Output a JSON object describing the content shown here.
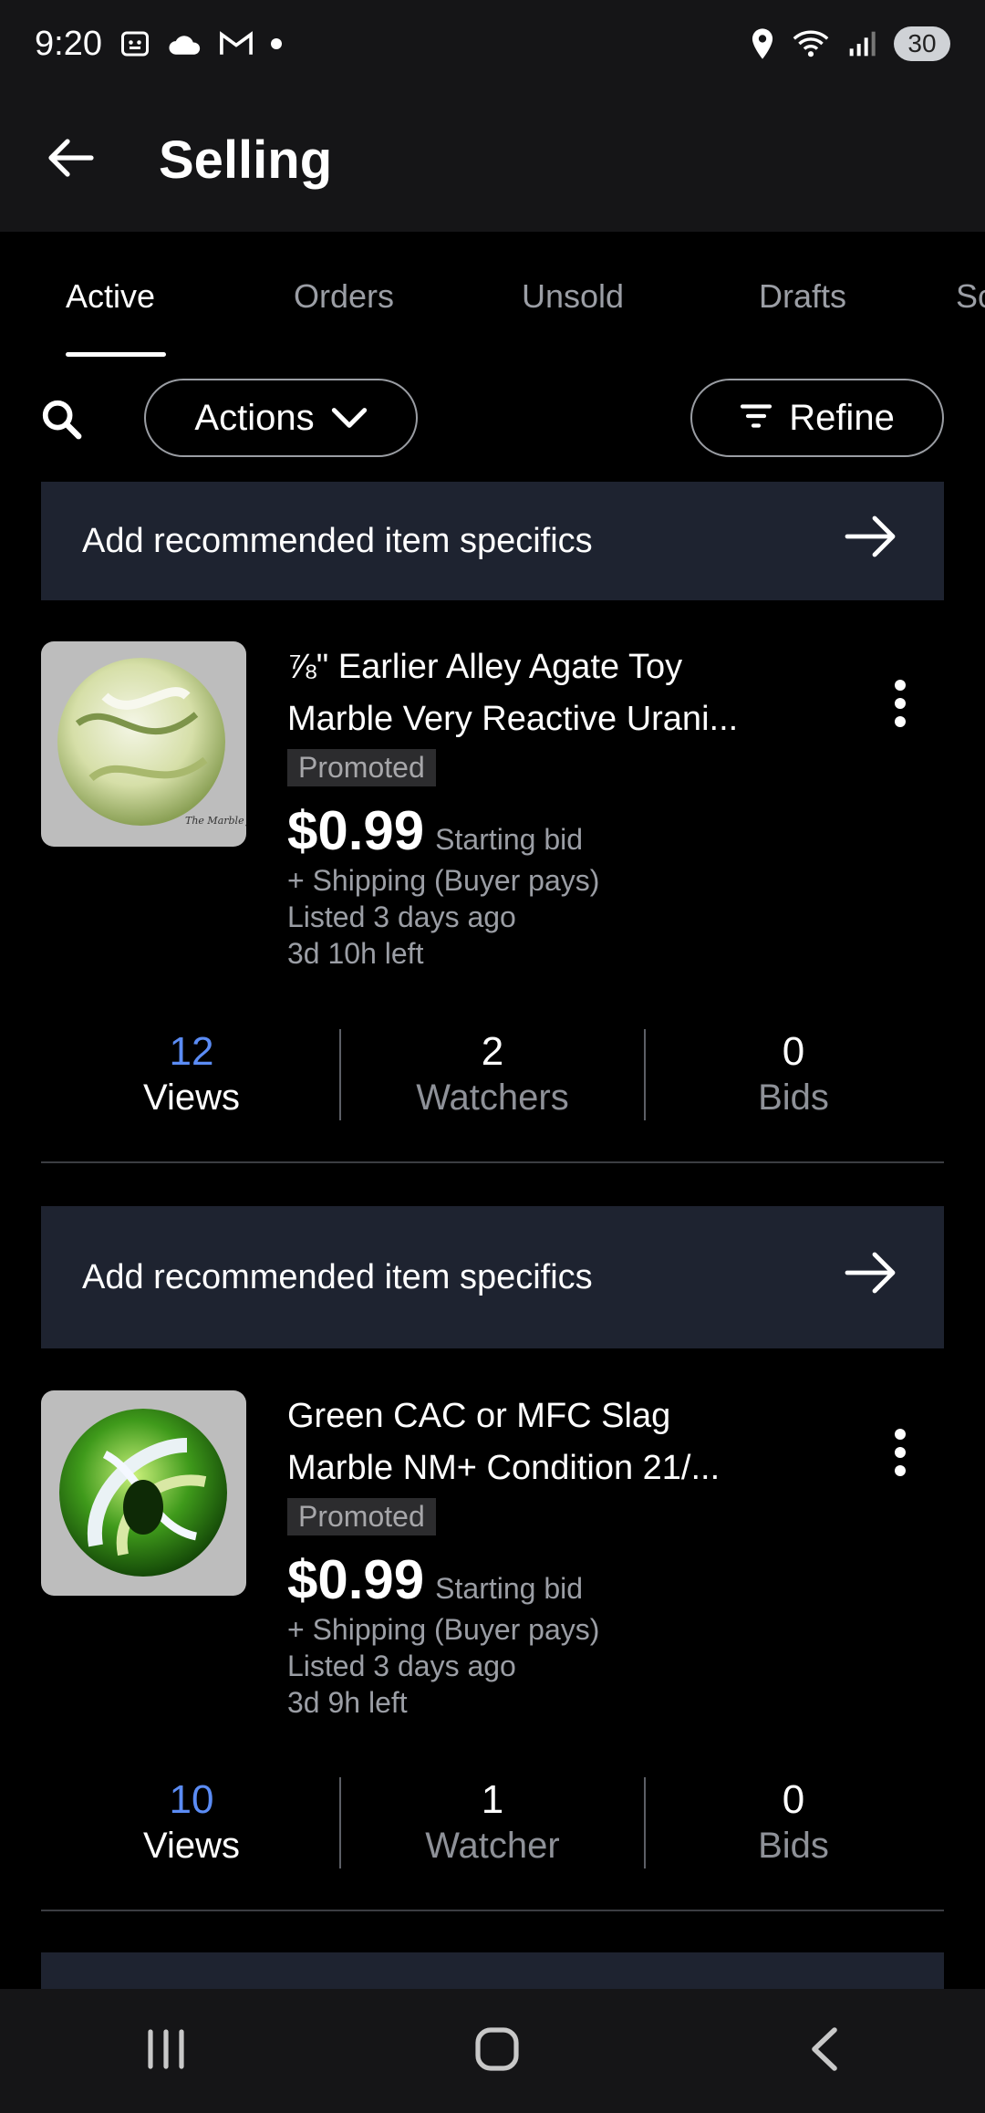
{
  "status_bar": {
    "time": "9:20",
    "battery": "30",
    "left_icons": [
      "screenshot-icon",
      "cloud-icon",
      "gmail-icon",
      "dot-icon"
    ],
    "right_icons": [
      "location-icon",
      "wifi-icon",
      "signal-icon"
    ]
  },
  "app_bar": {
    "title": "Selling"
  },
  "tabs": [
    {
      "label": "Active",
      "active": true
    },
    {
      "label": "Orders",
      "active": false
    },
    {
      "label": "Unsold",
      "active": false
    },
    {
      "label": "Drafts",
      "active": false
    },
    {
      "label": "Sc",
      "active": false
    }
  ],
  "toolbar": {
    "actions_label": "Actions",
    "refine_label": "Refine"
  },
  "banner_text": "Add recommended item specifics",
  "listings": [
    {
      "title_line1": "⅞\" Earlier Alley Agate Toy",
      "title_line2": "Marble Very Reactive Urani...",
      "badge": "Promoted",
      "price": "$0.99",
      "bid_type": "Starting bid",
      "shipping": "+ Shipping (Buyer pays)",
      "listed": "Listed 3 days ago",
      "time_left": "3d 10h left",
      "thumb_caption": "The Marble Junkie",
      "stats": {
        "views": "12",
        "views_label": "Views",
        "watchers": "2",
        "watchers_label": "Watchers",
        "bids": "0",
        "bids_label": "Bids"
      }
    },
    {
      "title_line1": "Green CAC or MFC Slag",
      "title_line2": "Marble NM+  Condition 21/...",
      "badge": "Promoted",
      "price": "$0.99",
      "bid_type": "Starting bid",
      "shipping": "+ Shipping (Buyer pays)",
      "listed": "Listed 3 days ago",
      "time_left": "3d 9h left",
      "stats": {
        "views": "10",
        "views_label": "Views",
        "watchers": "1",
        "watchers_label": "Watcher",
        "bids": "0",
        "bids_label": "Bids"
      }
    }
  ],
  "colors": {
    "accent_blue": "#5b8cf5",
    "banner_bg": "#1e2330",
    "bar_bg": "#151517"
  }
}
